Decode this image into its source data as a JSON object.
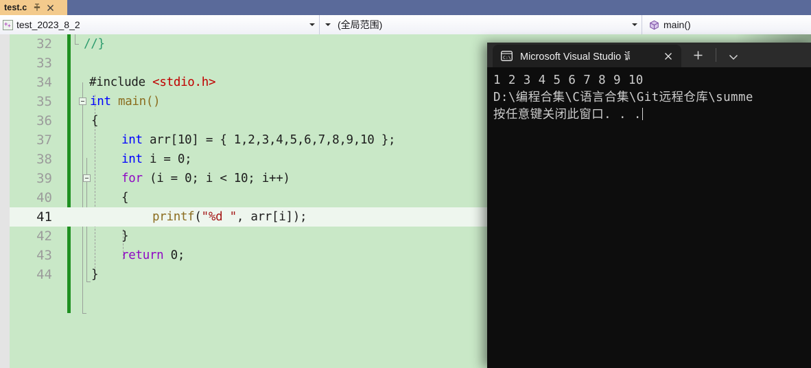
{
  "window": {
    "top_bar_color": "#5a6a9a"
  },
  "tabstrip": {
    "document_tab": {
      "label": "test.c",
      "pin_icon": "pin-icon",
      "close_icon": "close-icon"
    }
  },
  "navbar": {
    "project_selector": {
      "value": "test_2023_8_2",
      "icon": "cpp-project-icon",
      "dropdown_icon": "chevron-down-icon"
    },
    "scope_selector": {
      "value": "(全局范围)",
      "dropdown_icon": "chevron-down-icon"
    },
    "member_selector": {
      "value": "main()",
      "icon": "method-cube-icon"
    }
  },
  "editor": {
    "current_line": 41,
    "lines": [
      {
        "num": "32",
        "indent": 0
      },
      {
        "num": "33",
        "indent": 0
      },
      {
        "num": "34",
        "indent": 0
      },
      {
        "num": "35",
        "indent": 0
      },
      {
        "num": "36",
        "indent": 0
      },
      {
        "num": "37",
        "indent": 0
      },
      {
        "num": "38",
        "indent": 0
      },
      {
        "num": "39",
        "indent": 0
      },
      {
        "num": "40",
        "indent": 0
      },
      {
        "num": "41",
        "indent": 0
      },
      {
        "num": "42",
        "indent": 0
      },
      {
        "num": "43",
        "indent": 0
      },
      {
        "num": "44",
        "indent": 0
      }
    ],
    "code_text": {
      "l32": "//}",
      "l33": "",
      "l34_directive": "#include ",
      "l34_header": "<stdio.h>",
      "l35_kw": "int",
      "l35_rest": " main()",
      "l36": "{",
      "l37_kw": "int",
      "l37_rest": " arr[10] = { 1,2,3,4,5,6,7,8,9,10 };",
      "l38_kw": "int",
      "l38_rest": " i = 0;",
      "l39_kw": "for",
      "l39_rest": " (i = 0; i < 10; i++)",
      "l40": "{",
      "l41_fn": "printf",
      "l41_open": "(",
      "l41_str": "\"%d \"",
      "l41_rest": ", arr[i]);",
      "l42": "}",
      "l43_kw": "return",
      "l43_rest": " 0;",
      "l44": "}"
    },
    "colors": {
      "background": "#c9e8c7",
      "current_line": "#eef6ee",
      "change_bar": "#1f9021",
      "line_number": "#9b9b9b",
      "keyword": "#0000ff",
      "control_keyword": "#8f08c4",
      "function": "#8b6d1f",
      "string": "#a31515",
      "comment": "#2e9c6e",
      "include_path": "#c00000"
    }
  },
  "console": {
    "tab": {
      "title": "Microsoft Visual Studio 调试控",
      "icon": "cmd-prompt-icon",
      "close_icon": "close-icon"
    },
    "new_tab_icon": "plus-icon",
    "dropdown_icon": "chevron-down-icon",
    "output_lines": [
      "1 2 3 4 5 6 7 8 9 10",
      "D:\\编程合集\\C语言合集\\Git远程仓库\\summe",
      "按任意键关闭此窗口. . ."
    ],
    "colors": {
      "titlebar": "#2b2b2b",
      "tab": "#1f1f1f",
      "body": "#0d0d0d",
      "text": "#cccccc"
    }
  }
}
